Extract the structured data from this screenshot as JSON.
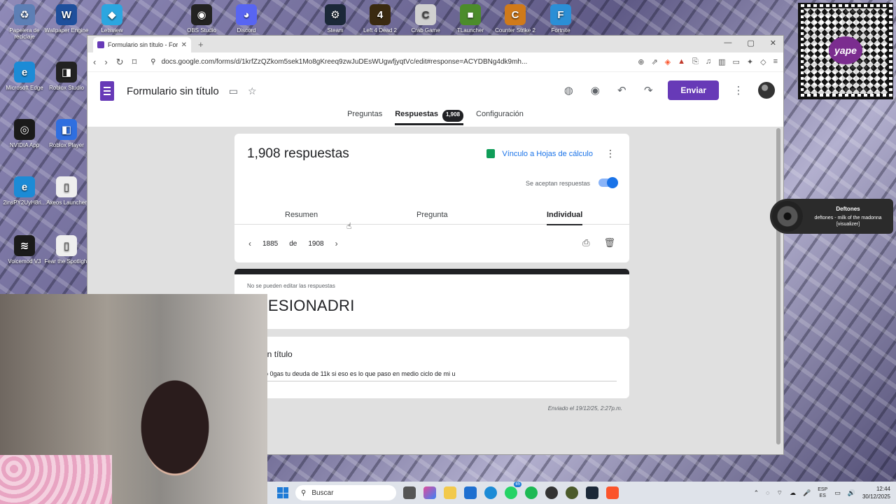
{
  "desktop": {
    "icons": [
      {
        "label": "Papelera de reciclaje",
        "color": "#5d7fb5",
        "glyph": "♻"
      },
      {
        "label": "Wallpaper Engine",
        "color": "#1e4f9c",
        "glyph": "W"
      },
      {
        "label": "Letsview",
        "color": "#2ca6e0",
        "glyph": "◆"
      },
      {
        "label": "OBS Studio",
        "color": "#222222",
        "glyph": "◉"
      },
      {
        "label": "Discord",
        "color": "#5865f2",
        "glyph": "◕"
      },
      {
        "label": "Steam",
        "color": "#1b2838",
        "glyph": "⚙"
      },
      {
        "label": "Left 4 Dead 2",
        "color": "#3a2a10",
        "glyph": "4"
      },
      {
        "label": "Crab Game",
        "color": "#d0d0d0",
        "glyph": "C"
      },
      {
        "label": "TLauncher",
        "color": "#4c8c2b",
        "glyph": "■"
      },
      {
        "label": "Counter Strike 2",
        "color": "#d07a1a",
        "glyph": "C"
      },
      {
        "label": "Fortnite",
        "color": "#2b8fd6",
        "glyph": "F"
      },
      {
        "label": "Microsoft Edge",
        "color": "#1c8bd6",
        "glyph": "e"
      },
      {
        "label": "Roblox Studio",
        "color": "#222222",
        "glyph": "◨"
      },
      {
        "label": "NVIDIA App",
        "color": "#1a1a1a",
        "glyph": "◎"
      },
      {
        "label": "Roblox Player",
        "color": "#2f6fe0",
        "glyph": "◧"
      },
      {
        "label": "2insPY2UyH8ri...",
        "color": "#1c8bd6",
        "glyph": "e"
      },
      {
        "label": "Axeos Launcher",
        "color": "#eeeeee",
        "glyph": "▯"
      },
      {
        "label": "Voicemod V3",
        "color": "#1a1a1a",
        "glyph": "≋"
      },
      {
        "label": "Fear the Spotlight",
        "color": "#eeeeee",
        "glyph": "▯"
      }
    ]
  },
  "browser": {
    "tab_title": "Formulario sin título - Formular...",
    "new_tab": "+",
    "url": "docs.google.com/forms/d/1krfZzQZkom5sek1Mo8gKreeq9zwJuDEsWUgwfjyqtVc/edit#response=ACYDBNg4dk9mh..."
  },
  "forms": {
    "title": "Formulario sin título",
    "send_label": "Enviar",
    "tabs": {
      "questions": "Preguntas",
      "responses": "Respuestas",
      "responses_badge": "1,908",
      "settings": "Configuración"
    },
    "summary": {
      "count": "1,908 respuestas",
      "sheets_link": "Vínculo a Hojas de cálculo",
      "accepting": "Se aceptan respuestas",
      "accepting_on": true,
      "sub_tabs": {
        "summary": "Resumen",
        "question": "Pregunta",
        "individual": "Individual"
      },
      "pager": {
        "current": "1885",
        "of_label": "de",
        "total": "1908"
      }
    },
    "response": {
      "note": "No se pueden editar las respuestas",
      "heading": "NFESIONADRI"
    },
    "question": {
      "title": "nta sin título",
      "answer": "omo no 0gas tu deuda de 11k si eso es lo que paso en medio ciclo de mi u"
    },
    "sent": "Enviado el 19/12/25, 2:27p.m."
  },
  "overlays": {
    "qr_brand": "yape",
    "now_playing": {
      "artist": "Deftones",
      "track": "deftones - milk of the madonna [visualizer]"
    }
  },
  "taskbar": {
    "search_placeholder": "Buscar",
    "whatsapp_badge": "65",
    "lang_top": "ESP",
    "lang_bottom": "ES",
    "time": "12:44",
    "date": "30/12/2025"
  }
}
